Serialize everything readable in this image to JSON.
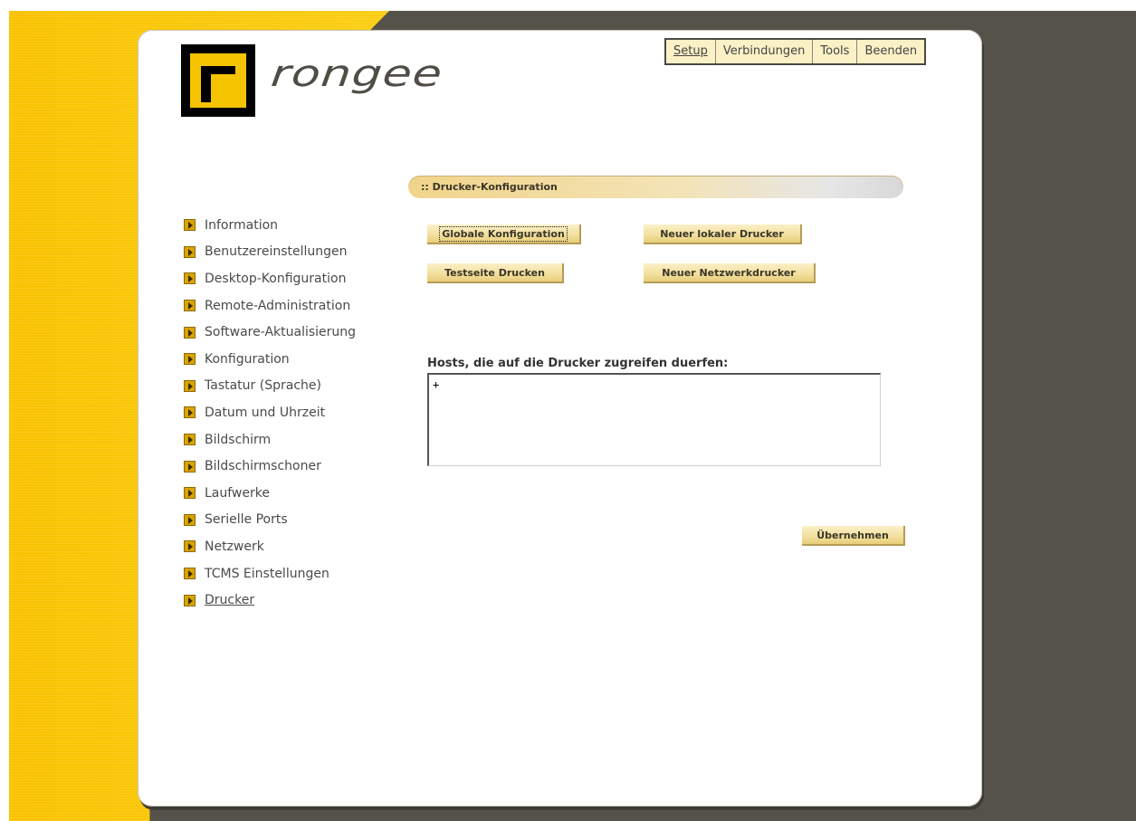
{
  "brand": {
    "name": "rongee"
  },
  "topnav": {
    "tabs": [
      {
        "label": "Setup",
        "active": true
      },
      {
        "label": "Verbindungen",
        "active": false
      },
      {
        "label": "Tools",
        "active": false
      },
      {
        "label": "Beenden",
        "active": false
      }
    ]
  },
  "section": {
    "title": ":: Drucker-Konfiguration"
  },
  "sidebar": {
    "items": [
      {
        "label": "Information"
      },
      {
        "label": "Benutzereinstellungen"
      },
      {
        "label": "Desktop-Konfiguration"
      },
      {
        "label": "Remote-Administration"
      },
      {
        "label": "Software-Aktualisierung"
      },
      {
        "label": "Konfiguration"
      },
      {
        "label": "Tastatur (Sprache)"
      },
      {
        "label": "Datum und Uhrzeit"
      },
      {
        "label": "Bildschirm"
      },
      {
        "label": "Bildschirmschoner"
      },
      {
        "label": "Laufwerke"
      },
      {
        "label": "Serielle Ports"
      },
      {
        "label": "Netzwerk"
      },
      {
        "label": "TCMS Einstellungen"
      },
      {
        "label": "Drucker",
        "active": true
      }
    ]
  },
  "buttons": {
    "global_config": "Globale Konfiguration",
    "new_local_printer": "Neuer lokaler Drucker",
    "print_test_page": "Testseite Drucken",
    "new_network_printer": "Neuer Netzwerkdrucker",
    "apply": "Übernehmen"
  },
  "hosts": {
    "label": "Hosts, die auf die Drucker zugreifen duerfen:",
    "value": "+"
  },
  "colors": {
    "accent_yellow": "#f9c200",
    "dark_background": "#55524a",
    "button_face": "#f2df9c"
  }
}
